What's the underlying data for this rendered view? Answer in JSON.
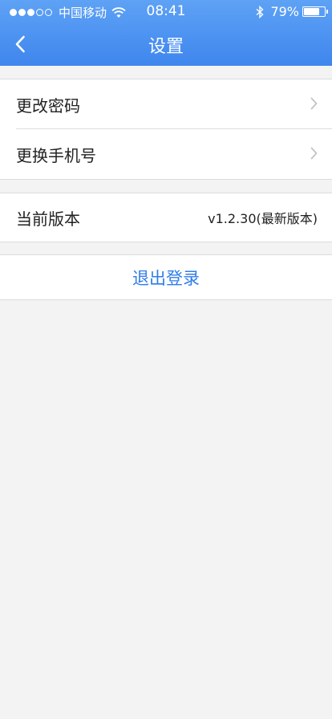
{
  "status_bar": {
    "carrier": "中国移动",
    "time": "08:41",
    "battery_percent": "79%",
    "battery_level": 0.79,
    "signal_strength": 3,
    "signal_max": 5
  },
  "nav": {
    "title": "设置",
    "back_icon": "chevron-left-icon"
  },
  "account_group": {
    "items": [
      {
        "label": "更改密码",
        "icon": "chevron-right-icon"
      },
      {
        "label": "更换手机号",
        "icon": "chevron-right-icon"
      }
    ]
  },
  "version": {
    "label": "当前版本",
    "value": "v1.2.30(最新版本)"
  },
  "logout": {
    "label": "退出登录"
  },
  "colors": {
    "header": "#4a90f0",
    "accent_text": "#2f7de8",
    "background": "#f3f3f3"
  }
}
